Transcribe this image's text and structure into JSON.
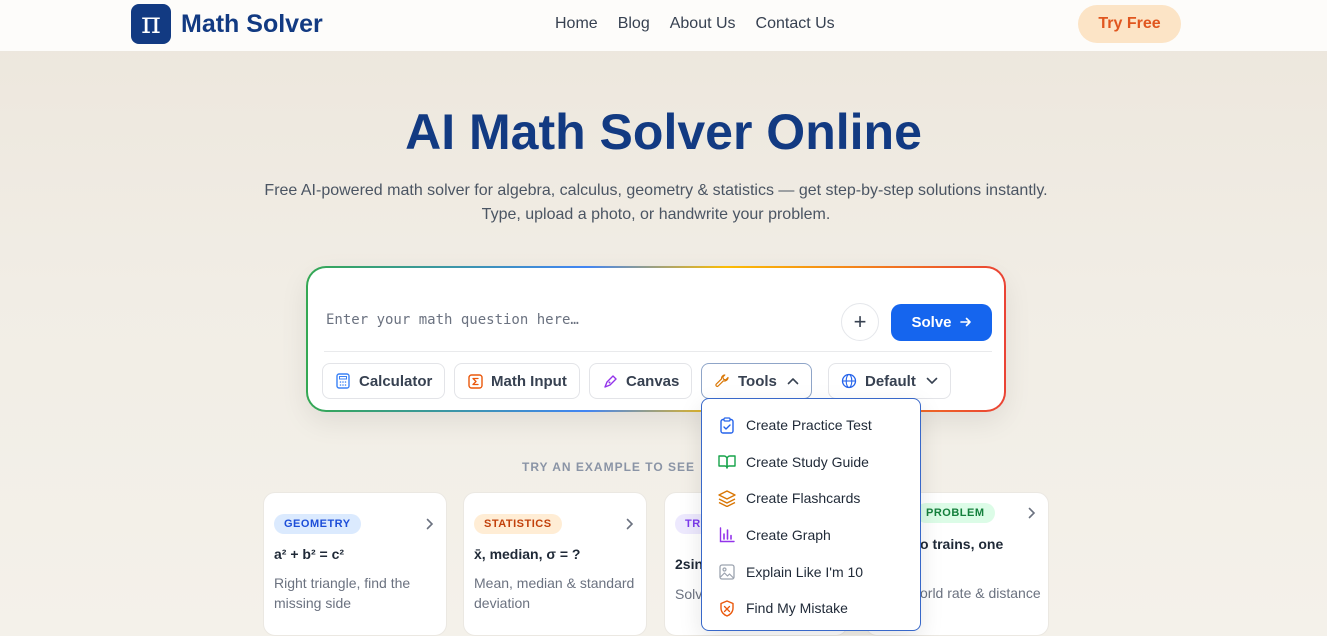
{
  "header": {
    "logo_symbol": "π",
    "logo_text": "Math Solver",
    "nav": [
      "Home",
      "Blog",
      "About Us",
      "Contact Us"
    ],
    "try_free": "Try Free"
  },
  "hero": {
    "title": "AI Math Solver Online",
    "subtitle": "Free AI-powered math solver for algebra, calculus, geometry & statistics — get step-by-step solutions instantly. Type, upload a photo, or handwrite your problem."
  },
  "input_card": {
    "placeholder": "Enter your math question here…",
    "value": "",
    "plus_label": "+",
    "solve_label": "Solve",
    "tools": {
      "calculator": "Calculator",
      "math_input": "Math Input",
      "canvas": "Canvas",
      "tools": "Tools",
      "language": "Default"
    }
  },
  "dropdown": {
    "items": [
      "Create Practice Test",
      "Create Study Guide",
      "Create Flashcards",
      "Create Graph",
      "Explain Like I'm 10",
      "Find My Mistake"
    ]
  },
  "examples": {
    "label": "TRY AN EXAMPLE TO SEE",
    "cards": [
      {
        "badge": "GEOMETRY",
        "formula": "a² + b² = c²",
        "desc": "Right triangle, find the missing side"
      },
      {
        "badge": "STATISTICS",
        "formula": "x̄, median, σ = ?",
        "desc": "Mean, median & standard deviation"
      },
      {
        "badge": "TRI",
        "formula": "2sin",
        "desc": "Solv"
      },
      {
        "badge": "PROBLEM",
        "formula": "o trains, one",
        "desc": "orld rate & distance"
      }
    ]
  },
  "colors": {
    "brand": "#123a82",
    "solve_blue": "#1565ee",
    "try_free_bg": "#fce4c6",
    "try_free_text": "#e0561f"
  }
}
